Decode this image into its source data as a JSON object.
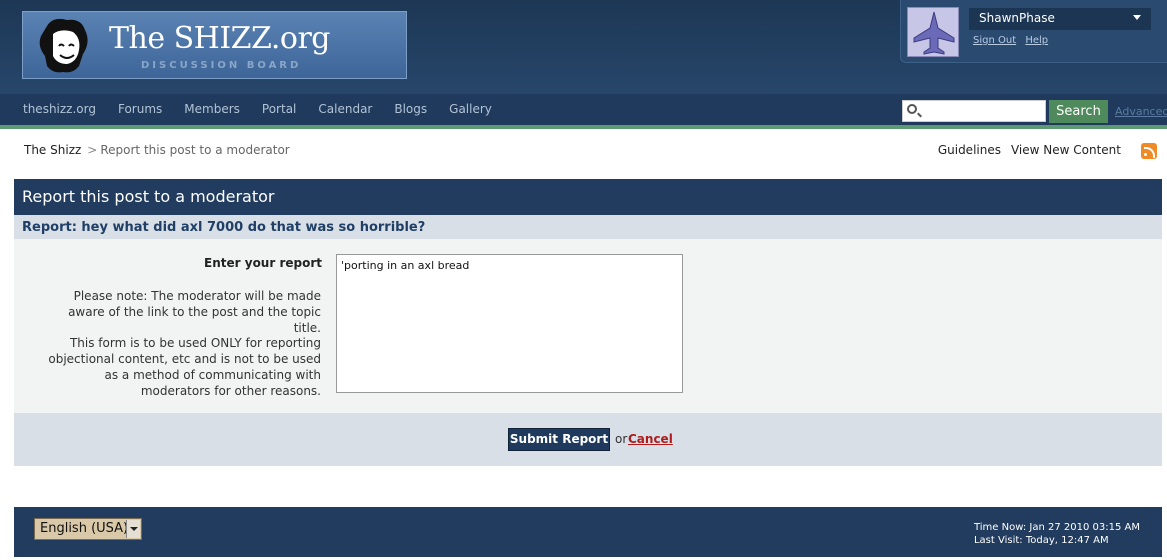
{
  "header": {
    "logo_title": "The SHIZZ.org",
    "logo_subtitle": "Discussion Board",
    "username": "ShawnPhase",
    "sign_out": "Sign Out",
    "help": "Help"
  },
  "nav": {
    "items": [
      "theshizz.org",
      "Forums",
      "Members",
      "Portal",
      "Calendar",
      "Blogs",
      "Gallery"
    ],
    "search_button": "Search",
    "advanced": "Advanced",
    "search_value": ""
  },
  "breadcrumb": {
    "home": "The Shizz",
    "separator": ">",
    "current": "Report this post to a moderator"
  },
  "top_links": [
    "Guidelines",
    "View New Content"
  ],
  "panel": {
    "heading": "Report this post to a moderator",
    "report_title": "Report: hey what did axl 7000 do that was so horrible?"
  },
  "form": {
    "label": "Enter your report",
    "note1": "Please note: The moderator will be made aware of the link to the post and the topic title.",
    "note2": "This form is to be used ONLY for reporting objectional content, etc and is not to be used as a method of communicating with moderators for other reasons.",
    "report_value": "'porting in an axl bread",
    "submit": "Submit Report",
    "or": "or",
    "cancel": "Cancel"
  },
  "footer": {
    "language": "English (USA)",
    "time_now": "Time Now: Jan 27 2010 03:15 AM",
    "last_visit": "Last Visit: Today, 12:47 AM"
  },
  "colors": {
    "header_bg": "#1d3755",
    "nav_bg": "#1f3a5c",
    "accent_green": "#5c9a73",
    "cancel_red": "#b01c1c"
  }
}
